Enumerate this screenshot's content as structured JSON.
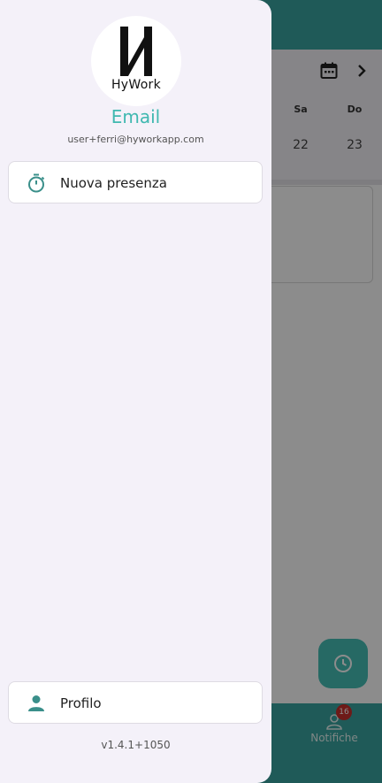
{
  "background": {
    "calendar_icon": "calendar-icon",
    "next_icon": "chevron-right-icon",
    "days": [
      {
        "name": "Sa",
        "number": "22"
      },
      {
        "name": "Do",
        "number": "23"
      }
    ],
    "fab_icon": "clock-icon",
    "bottom_nav": {
      "notifiche_label": "Notifiche",
      "notifiche_badge": "16"
    }
  },
  "drawer": {
    "logo_text": "HyWork",
    "title": "Email",
    "email": "user+ferri@hyworkapp.com",
    "items": [
      {
        "label": "Nuova presenza",
        "icon": "stopwatch-icon"
      },
      {
        "label": "Profilo",
        "icon": "person-icon"
      }
    ],
    "version": "v1.4.1+1050"
  },
  "colors": {
    "accent": "#3fb8b0",
    "appbar": "#3aa5a0"
  }
}
